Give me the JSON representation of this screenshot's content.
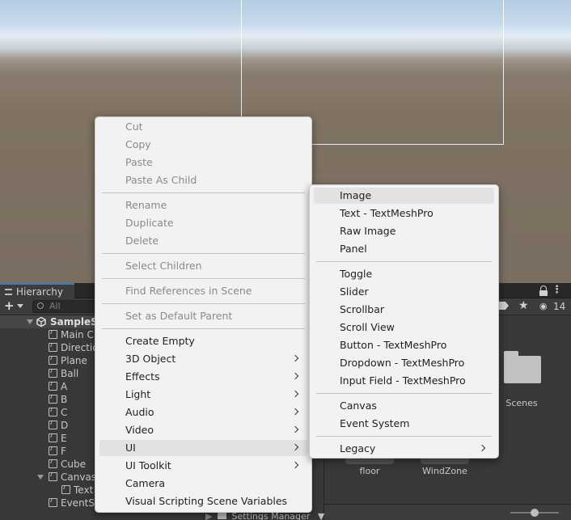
{
  "hierarchy": {
    "tab_label": "Hierarchy",
    "add_symbol": "+",
    "search_placeholder": "All",
    "scene_name": "SampleSc",
    "items": [
      {
        "label": "Main C",
        "indent": 1,
        "type": "object"
      },
      {
        "label": "Directio",
        "indent": 1,
        "type": "object"
      },
      {
        "label": "Plane",
        "indent": 1,
        "type": "object"
      },
      {
        "label": "Ball",
        "indent": 1,
        "type": "object"
      },
      {
        "label": "A",
        "indent": 1,
        "type": "object"
      },
      {
        "label": "B",
        "indent": 1,
        "type": "object"
      },
      {
        "label": "C",
        "indent": 1,
        "type": "object"
      },
      {
        "label": "D",
        "indent": 1,
        "type": "object"
      },
      {
        "label": "E",
        "indent": 1,
        "type": "object"
      },
      {
        "label": "F",
        "indent": 1,
        "type": "object"
      },
      {
        "label": "Cube",
        "indent": 1,
        "type": "object"
      },
      {
        "label": "Canvas",
        "indent": 1,
        "type": "object",
        "expanded": true
      },
      {
        "label": "Text",
        "indent": 2,
        "type": "object"
      },
      {
        "label": "EventS",
        "indent": 1,
        "type": "object"
      }
    ]
  },
  "project": {
    "hidden_count": "14",
    "assets": [
      {
        "label": "Scenes",
        "kind": "folder"
      },
      {
        "label": "floor",
        "kind": "asset"
      },
      {
        "label": "WindZone",
        "kind": "asset"
      }
    ],
    "settings_row_label": "Settings Manager"
  },
  "context_menu": {
    "items": [
      {
        "label": "Cut",
        "disabled": true
      },
      {
        "label": "Copy",
        "disabled": true
      },
      {
        "label": "Paste",
        "disabled": true
      },
      {
        "label": "Paste As Child",
        "disabled": true
      },
      {
        "label": "Rename",
        "disabled": true
      },
      {
        "label": "Duplicate",
        "disabled": true
      },
      {
        "label": "Delete",
        "disabled": true
      },
      {
        "label": "Select Children",
        "disabled": true
      },
      {
        "label": "Find References in Scene",
        "disabled": true
      },
      {
        "label": "Set as Default Parent",
        "disabled": true
      },
      {
        "label": "Create Empty",
        "disabled": false
      },
      {
        "label": "3D Object",
        "disabled": false,
        "submenu": true
      },
      {
        "label": "Effects",
        "disabled": false,
        "submenu": true
      },
      {
        "label": "Light",
        "disabled": false,
        "submenu": true
      },
      {
        "label": "Audio",
        "disabled": false,
        "submenu": true
      },
      {
        "label": "Video",
        "disabled": false,
        "submenu": true
      },
      {
        "label": "UI",
        "disabled": false,
        "submenu": true,
        "highlighted": true
      },
      {
        "label": "UI Toolkit",
        "disabled": false,
        "submenu": true
      },
      {
        "label": "Camera",
        "disabled": false
      },
      {
        "label": "Visual Scripting Scene Variables",
        "disabled": false
      }
    ]
  },
  "ui_submenu": {
    "items": [
      {
        "label": "Image",
        "highlighted": true
      },
      {
        "label": "Text - TextMeshPro"
      },
      {
        "label": "Raw Image"
      },
      {
        "label": "Panel"
      },
      {
        "label": "Toggle"
      },
      {
        "label": "Slider"
      },
      {
        "label": "Scrollbar"
      },
      {
        "label": "Scroll View"
      },
      {
        "label": "Button - TextMeshPro"
      },
      {
        "label": "Dropdown - TextMeshPro"
      },
      {
        "label": "Input Field - TextMeshPro"
      },
      {
        "label": "Canvas"
      },
      {
        "label": "Event System"
      },
      {
        "label": "Legacy",
        "submenu": true
      }
    ]
  },
  "colors": {
    "menu_bg": "#f2f2f2",
    "menu_highlight": "#e2e2e2",
    "disabled_text": "#8a8a8a",
    "editor_bg": "#383838",
    "tab_accent": "#3a79bb"
  }
}
